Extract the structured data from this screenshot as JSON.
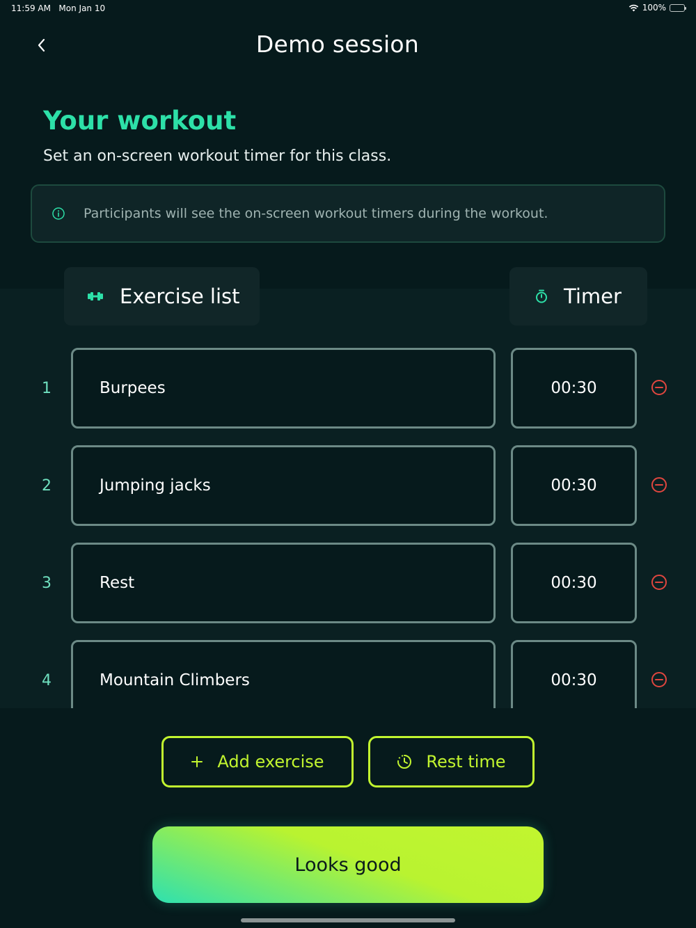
{
  "status_bar": {
    "time": "11:59 AM",
    "date": "Mon Jan 10",
    "battery": "100%"
  },
  "header": {
    "title": "Demo session",
    "back_icon": "chevron-left-icon"
  },
  "workout": {
    "title": "Your workout",
    "subtitle": "Set an on-screen workout timer for this class.",
    "info": "Participants will see the on-screen workout timers during the workout."
  },
  "columns": {
    "exercise_label": "Exercise list",
    "timer_label": "Timer"
  },
  "exercises": [
    {
      "number": "1",
      "name": "Burpees",
      "timer": "00:30"
    },
    {
      "number": "2",
      "name": "Jumping jacks",
      "timer": "00:30"
    },
    {
      "number": "3",
      "name": "Rest",
      "timer": "00:30"
    },
    {
      "number": "4",
      "name": "Mountain Climbers",
      "timer": "00:30"
    }
  ],
  "actions": {
    "add_exercise": "Add exercise",
    "rest_time": "Rest time",
    "confirm": "Looks good"
  },
  "colors": {
    "background": "#061a1c",
    "accent_green": "#2de0a8",
    "accent_lime": "#c2f52f",
    "remove_red": "#e0463f"
  }
}
